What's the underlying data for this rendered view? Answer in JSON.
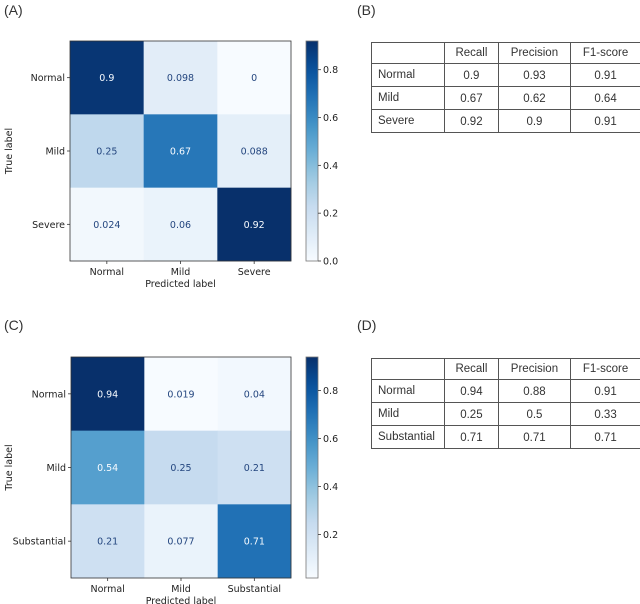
{
  "panels": {
    "A": "(A)",
    "B": "(B)",
    "C": "(C)",
    "D": "(D)"
  },
  "chart_data": [
    {
      "type": "heatmap",
      "panel": "(A)",
      "title": "",
      "xlabel": "Predicted label",
      "ylabel": "True label",
      "x_categories": [
        "Normal",
        "Mild",
        "Severe"
      ],
      "y_categories": [
        "Normal",
        "Mild",
        "Severe"
      ],
      "values": [
        [
          0.9,
          0.098,
          0
        ],
        [
          0.25,
          0.67,
          0.088
        ],
        [
          0.024,
          0.06,
          0.92
        ]
      ],
      "value_labels": [
        [
          "0.9",
          "0.098",
          "0"
        ],
        [
          "0.25",
          "0.67",
          "0.088"
        ],
        [
          "0.024",
          "0.06",
          "0.92"
        ]
      ],
      "colormap": "Blues",
      "colorbar": {
        "range": [
          0,
          0.92
        ],
        "ticks": [
          0.0,
          0.2,
          0.4,
          0.6,
          0.8
        ],
        "tick_labels": [
          "0.0",
          "0.2",
          "0.4",
          "0.6",
          "0.8"
        ],
        "placement": "right"
      }
    },
    {
      "type": "heatmap",
      "panel": "(C)",
      "title": "",
      "xlabel": "Predicted label",
      "ylabel": "True label",
      "x_categories": [
        "Normal",
        "Mild",
        "Substantial"
      ],
      "y_categories": [
        "Normal",
        "Mild",
        "Substantial"
      ],
      "values": [
        [
          0.94,
          0.019,
          0.04
        ],
        [
          0.54,
          0.25,
          0.21
        ],
        [
          0.21,
          0.077,
          0.71
        ]
      ],
      "value_labels": [
        [
          "0.94",
          "0.019",
          "0.04"
        ],
        [
          "0.54",
          "0.25",
          "0.21"
        ],
        [
          "0.21",
          "0.077",
          "0.71"
        ]
      ],
      "colormap": "Blues",
      "colorbar": {
        "range": [
          0.019,
          0.94
        ],
        "ticks": [
          0.2,
          0.4,
          0.6,
          0.8
        ],
        "tick_labels": [
          "0.2",
          "0.4",
          "0.6",
          "0.8"
        ],
        "placement": "right"
      }
    },
    {
      "type": "table",
      "panel": "(B)",
      "columns": [
        "",
        "Recall",
        "Precision",
        "F1-score"
      ],
      "rows": [
        {
          "label": "Normal",
          "values": [
            "0.9",
            "0.93",
            "0.91"
          ]
        },
        {
          "label": "Mild",
          "values": [
            "0.67",
            "0.62",
            "0.64"
          ]
        },
        {
          "label": "Severe",
          "values": [
            "0.92",
            "0.9",
            "0.91"
          ]
        }
      ]
    },
    {
      "type": "table",
      "panel": "(D)",
      "columns": [
        "",
        "Recall",
        "Precision",
        "F1-score"
      ],
      "rows": [
        {
          "label": "Normal",
          "values": [
            "0.94",
            "0.88",
            "0.91"
          ]
        },
        {
          "label": "Mild",
          "values": [
            "0.25",
            "0.5",
            "0.33"
          ]
        },
        {
          "label": "Substantial",
          "values": [
            "0.71",
            "0.71",
            "0.71"
          ]
        }
      ]
    }
  ]
}
